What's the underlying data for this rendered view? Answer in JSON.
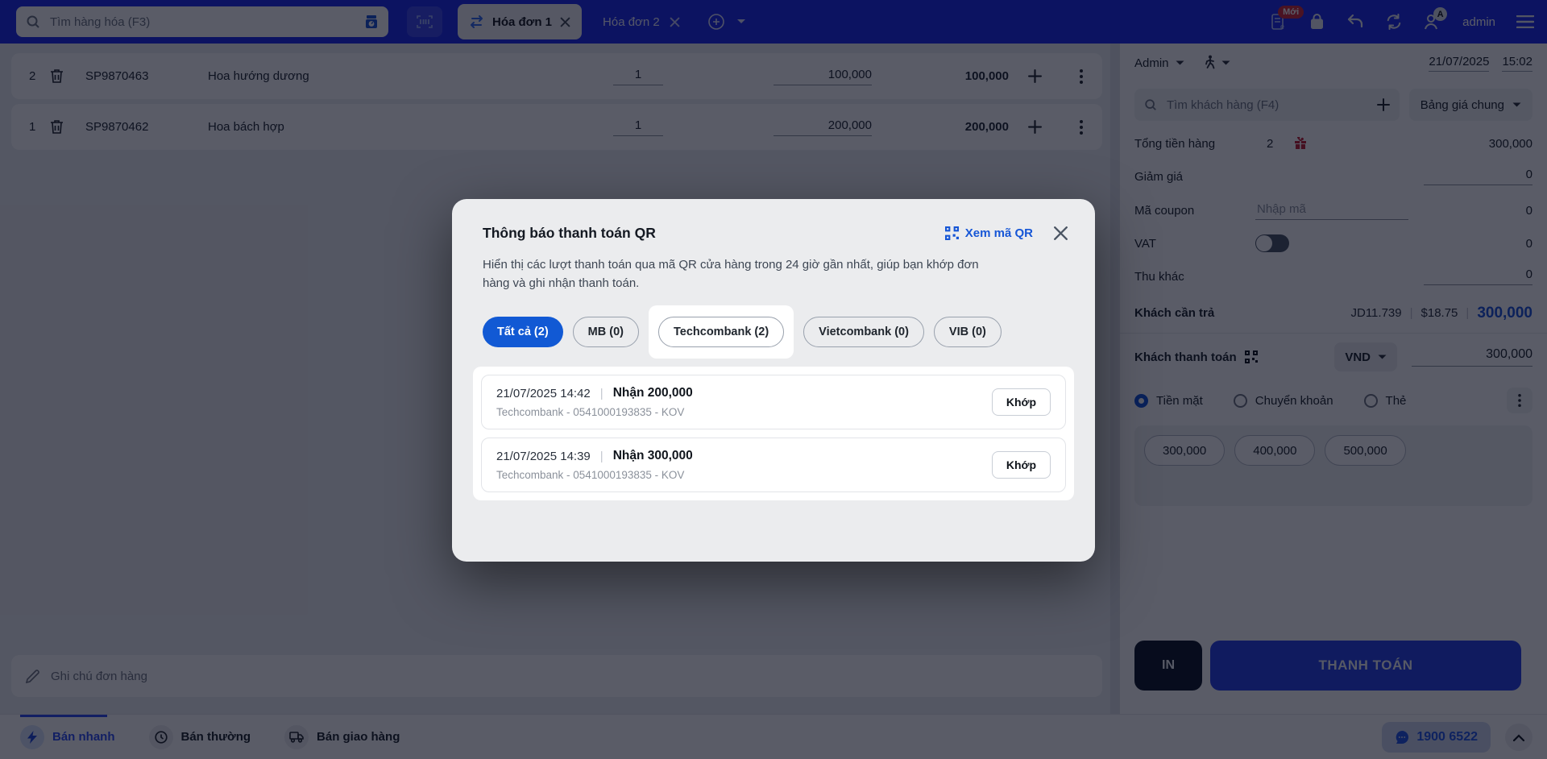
{
  "topbar": {
    "search_placeholder": "Tìm hàng hóa (F3)",
    "tabs": [
      {
        "label": "Hóa đơn 1"
      },
      {
        "label": "Hóa đơn 2"
      }
    ],
    "new_badge": "Mới",
    "user_badge": "A",
    "username": "admin"
  },
  "products": {
    "rows": [
      {
        "index": "2",
        "code": "SP9870463",
        "name": "Hoa hướng dương",
        "qty": "1",
        "price": "100,000",
        "total": "100,000"
      },
      {
        "index": "1",
        "code": "SP9870462",
        "name": "Hoa bách hợp",
        "qty": "1",
        "price": "200,000",
        "total": "200,000"
      }
    ]
  },
  "note": {
    "placeholder": "Ghi chú đơn hàng"
  },
  "bottom_tabs": [
    {
      "label": "Bán nhanh"
    },
    {
      "label": "Bán thường"
    },
    {
      "label": "Bán giao hàng"
    }
  ],
  "hotline": {
    "phone": "1900 6522"
  },
  "sidebar": {
    "seller": "Admin",
    "date": "21/07/2025",
    "time": "15:02",
    "customer_search_placeholder": "Tìm khách hàng (F4)",
    "price_table": "Bảng giá chung",
    "total_label": "Tổng tiền hàng",
    "total_count": "2",
    "total_value": "300,000",
    "discount_label": "Giảm giá",
    "discount_value": "0",
    "coupon_label": "Mã coupon",
    "coupon_placeholder": "Nhập mã",
    "coupon_value": "0",
    "vat_label": "VAT",
    "vat_value": "0",
    "other_label": "Thu khác",
    "other_value": "0",
    "due_label": "Khách cần trả",
    "due_jd": "JD11.739",
    "due_usd": "$18.75",
    "due_vnd": "300,000",
    "paid_label": "Khách thanh toán",
    "currency": "VND",
    "paid_value": "300,000",
    "payment_methods": [
      {
        "label": "Tiền mặt"
      },
      {
        "label": "Chuyển khoản"
      },
      {
        "label": "Thẻ"
      }
    ],
    "quick_amounts": [
      {
        "label": "300,000"
      },
      {
        "label": "400,000"
      },
      {
        "label": "500,000"
      }
    ],
    "print_label": "IN",
    "pay_label": "THANH TOÁN"
  },
  "modal": {
    "title": "Thông báo thanh toán QR",
    "view_qr": "Xem mã QR",
    "description": "Hiển thị các lượt thanh toán qua mã QR cửa hàng trong 24 giờ gần nhất, giúp bạn khớp đơn hàng và ghi nhận thanh toán.",
    "filters": [
      {
        "label": "Tất cả (2)"
      },
      {
        "label": "MB (0)"
      },
      {
        "label": "Techcombank (2)"
      },
      {
        "label": "Vietcombank (0)"
      },
      {
        "label": "VIB (0)"
      }
    ],
    "transactions": [
      {
        "datetime": "21/07/2025 14:42",
        "amount": "Nhận 200,000",
        "detail": "Techcombank - 0541000193835 - KOV",
        "action": "Khớp"
      },
      {
        "datetime": "21/07/2025 14:39",
        "amount": "Nhận 300,000",
        "detail": "Techcombank - 0541000193835 - KOV",
        "action": "Khớp"
      }
    ]
  }
}
